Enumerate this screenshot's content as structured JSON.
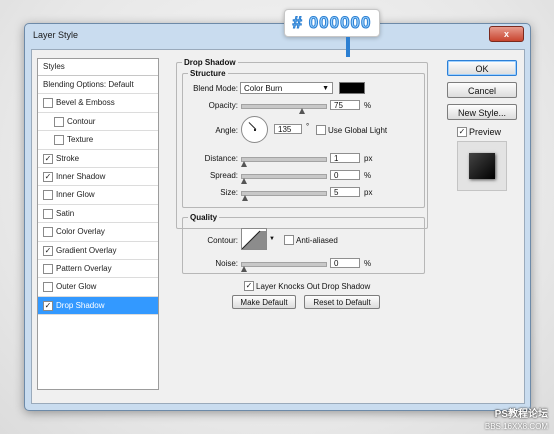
{
  "window": {
    "title": "Layer Style",
    "close_glyph": "x"
  },
  "styles_panel": {
    "header": "Styles",
    "items": [
      {
        "label": "Blending Options: Default",
        "checkbox": false,
        "checked": false,
        "indent": false,
        "selected": false
      },
      {
        "label": "Bevel & Emboss",
        "checkbox": true,
        "checked": false,
        "indent": false,
        "selected": false
      },
      {
        "label": "Contour",
        "checkbox": true,
        "checked": false,
        "indent": true,
        "selected": false
      },
      {
        "label": "Texture",
        "checkbox": true,
        "checked": false,
        "indent": true,
        "selected": false
      },
      {
        "label": "Stroke",
        "checkbox": true,
        "checked": true,
        "indent": false,
        "selected": false
      },
      {
        "label": "Inner Shadow",
        "checkbox": true,
        "checked": true,
        "indent": false,
        "selected": false
      },
      {
        "label": "Inner Glow",
        "checkbox": true,
        "checked": false,
        "indent": false,
        "selected": false
      },
      {
        "label": "Satin",
        "checkbox": true,
        "checked": false,
        "indent": false,
        "selected": false
      },
      {
        "label": "Color Overlay",
        "checkbox": true,
        "checked": false,
        "indent": false,
        "selected": false
      },
      {
        "label": "Gradient Overlay",
        "checkbox": true,
        "checked": true,
        "indent": false,
        "selected": false
      },
      {
        "label": "Pattern Overlay",
        "checkbox": true,
        "checked": false,
        "indent": false,
        "selected": false
      },
      {
        "label": "Outer Glow",
        "checkbox": true,
        "checked": false,
        "indent": false,
        "selected": false
      },
      {
        "label": "Drop Shadow",
        "checkbox": true,
        "checked": true,
        "indent": false,
        "selected": true
      }
    ]
  },
  "drop_shadow": {
    "section_title": "Drop Shadow",
    "structure_title": "Structure",
    "blend_mode": {
      "label": "Blend Mode:",
      "value": "Color Burn",
      "swatch_color": "#000000"
    },
    "opacity": {
      "label": "Opacity:",
      "value": "75",
      "unit": "%",
      "level": 0.75
    },
    "angle": {
      "label": "Angle:",
      "value": "135",
      "unit": "°",
      "global_light_label": "Use Global Light",
      "global_light_checked": false
    },
    "distance": {
      "label": "Distance:",
      "value": "1",
      "unit": "px",
      "level": 0.01
    },
    "spread": {
      "label": "Spread:",
      "value": "0",
      "unit": "%",
      "level": 0
    },
    "size": {
      "label": "Size:",
      "value": "5",
      "unit": "px",
      "level": 0.02
    },
    "quality_title": "Quality",
    "contour": {
      "label": "Contour:",
      "anti_aliased_label": "Anti-aliased",
      "anti_aliased_checked": false
    },
    "noise": {
      "label": "Noise:",
      "value": "0",
      "unit": "%",
      "level": 0
    },
    "knockout": {
      "label": "Layer Knocks Out Drop Shadow",
      "checked": true
    },
    "make_default_label": "Make Default",
    "reset_default_label": "Reset to Default"
  },
  "buttons": {
    "ok": "OK",
    "cancel": "Cancel",
    "new_style": "New Style..."
  },
  "preview": {
    "label": "Preview",
    "checked": true
  },
  "tooltip": {
    "text": "# 000000"
  },
  "watermark": {
    "line1": "PS教程论坛",
    "line2": "BBS.16XX8.COM"
  },
  "colors": {
    "accent": "#3399ff",
    "tooltip_text": "#2b7fd2",
    "close": "#c8452f"
  }
}
